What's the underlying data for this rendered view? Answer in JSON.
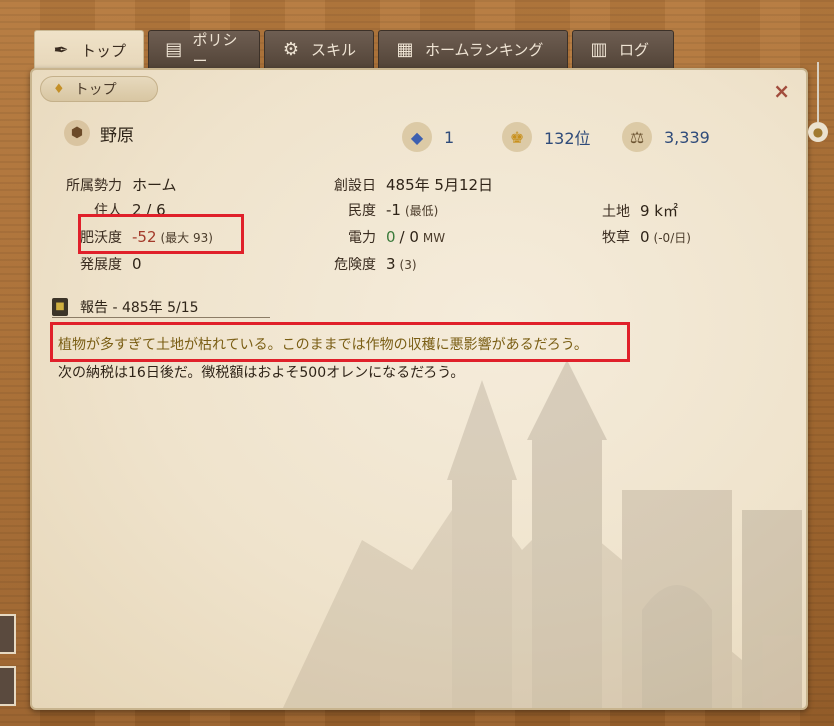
{
  "tabs": [
    {
      "label": "トップ",
      "icon": "quill-pen-icon",
      "active": true
    },
    {
      "label": "ポリシー",
      "icon": "scroll-icon",
      "active": false
    },
    {
      "label": "スキル",
      "icon": "gear-icon",
      "active": false
    },
    {
      "label": "ホームランキング",
      "icon": "ranking-book-icon",
      "active": false
    },
    {
      "label": "ログ",
      "icon": "log-scroll-icon",
      "active": false
    }
  ],
  "breadcrumb": {
    "label": "トップ"
  },
  "close_glyph": "×",
  "home": {
    "name": "野原"
  },
  "stats": {
    "crystal": "1",
    "rank": "132位",
    "balance": "3,339"
  },
  "fields": {
    "faction": {
      "label": "所属勢力",
      "value": "ホーム"
    },
    "residents": {
      "label": "住人",
      "value": "2 / 6"
    },
    "fertility": {
      "label": "肥沃度",
      "value": "-52",
      "note": "(最大 93)"
    },
    "development": {
      "label": "発展度",
      "value": "0"
    },
    "founded": {
      "label": "創設日",
      "value": "485年 5月12日"
    },
    "morale": {
      "label": "民度",
      "value": "-1",
      "note": "(最低)"
    },
    "power": {
      "label": "電力",
      "value_a": "0",
      "value_b": "/ 0",
      "unit": "MW"
    },
    "danger": {
      "label": "危険度",
      "value": "3",
      "note": "(3)"
    },
    "land": {
      "label": "土地",
      "value": "9 k㎡"
    },
    "pasture": {
      "label": "牧草",
      "value": "0",
      "note": "(-0/日)"
    }
  },
  "report": {
    "title": "報告 - 485年 5/15",
    "messages": [
      "植物が多すぎて土地が枯れている。このままでは作物の収穫に悪影響があるだろう。",
      "次の納税は16日後だ。徴税額はおよそ500オレンになるだろう。"
    ]
  }
}
